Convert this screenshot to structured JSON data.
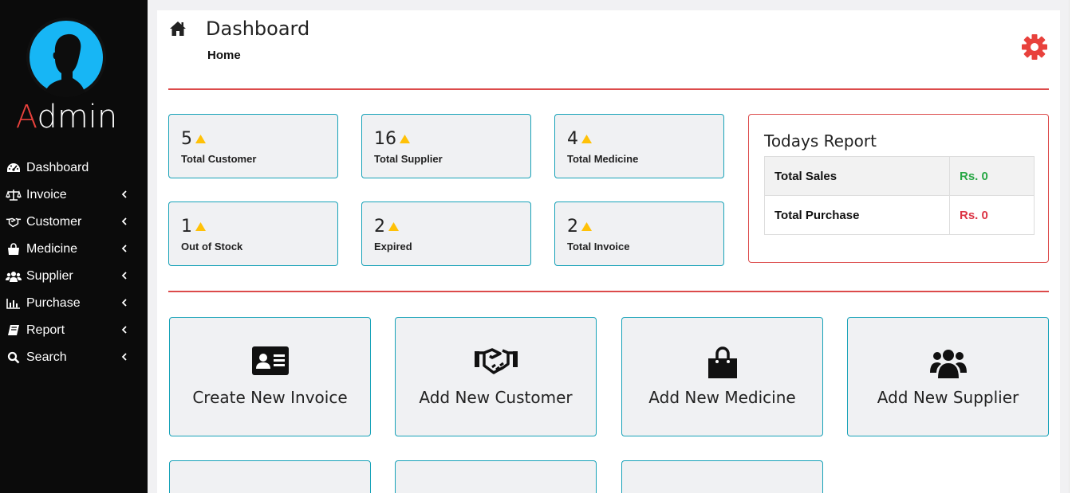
{
  "sidebar": {
    "brand": "Admin",
    "brand_initial": "A",
    "brand_rest": "dmin",
    "items": [
      {
        "label": "Dashboard",
        "icon": "tachometer-icon"
      },
      {
        "label": "Invoice",
        "icon": "balance-scale-icon"
      },
      {
        "label": "Customer",
        "icon": "handshake-icon"
      },
      {
        "label": "Medicine",
        "icon": "shopping-bag-icon"
      },
      {
        "label": "Supplier",
        "icon": "users-icon"
      },
      {
        "label": "Purchase",
        "icon": "bar-chart-icon"
      },
      {
        "label": "Report",
        "icon": "book-icon"
      },
      {
        "label": "Search",
        "icon": "search-icon"
      }
    ]
  },
  "header": {
    "title": "Dashboard",
    "breadcrumb": "Home"
  },
  "stats": [
    {
      "value": "5",
      "label": "Total Customer"
    },
    {
      "value": "16",
      "label": "Total Supplier"
    },
    {
      "value": "4",
      "label": "Total Medicine"
    },
    {
      "value": "1",
      "label": "Out of Stock"
    },
    {
      "value": "2",
      "label": "Expired"
    },
    {
      "value": "2",
      "label": "Total Invoice"
    }
  ],
  "report": {
    "title": "Todays Report",
    "rows": [
      {
        "label": "Total Sales",
        "value": "Rs. 0",
        "color": "#28a745"
      },
      {
        "label": "Total Purchase",
        "value": "Rs. 0",
        "color": "#dc3545"
      }
    ]
  },
  "actions": [
    {
      "label": "Create New Invoice",
      "icon": "id-card-icon"
    },
    {
      "label": "Add New Customer",
      "icon": "handshake-icon"
    },
    {
      "label": "Add New Medicine",
      "icon": "shopping-bag-icon"
    },
    {
      "label": "Add New Supplier",
      "icon": "users-icon"
    }
  ],
  "colors": {
    "accent": "#17a2b8",
    "divider": "#dc4a4a",
    "warning": "#ffc107",
    "gear": "#e8413c",
    "sidebar_bg": "#0b0b0b"
  }
}
